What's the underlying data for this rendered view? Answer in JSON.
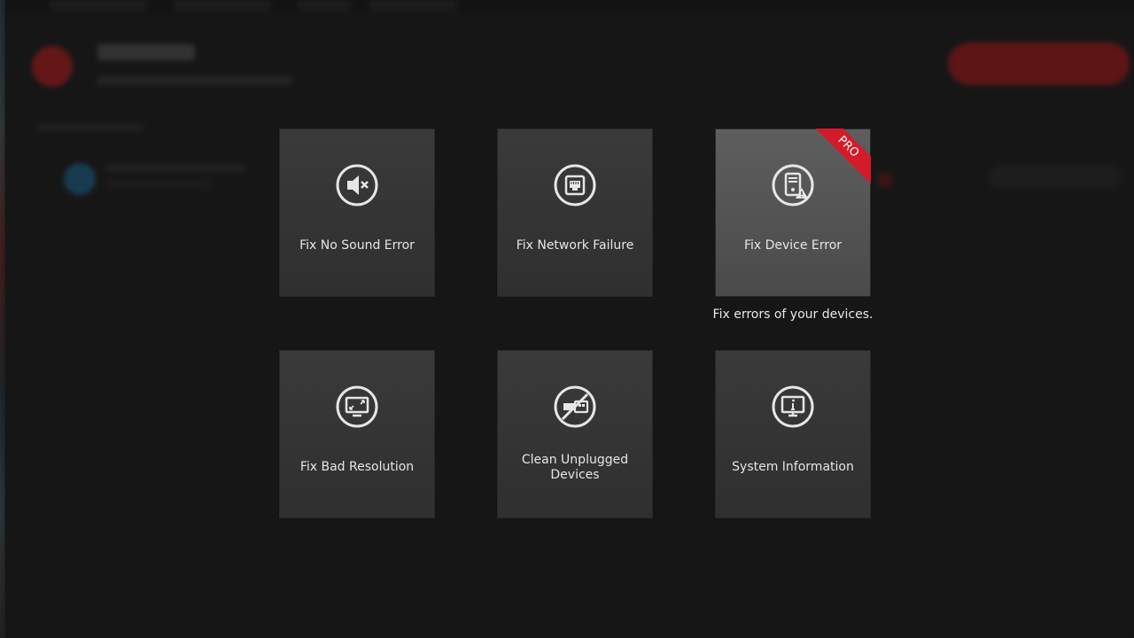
{
  "tiles": [
    {
      "label": "Fix No Sound Error",
      "icon": "mute-speaker-icon"
    },
    {
      "label": "Fix Network Failure",
      "icon": "network-port-icon"
    },
    {
      "label": "Fix Device Error",
      "icon": "device-warning-icon",
      "badge": "PRO"
    },
    {
      "label": "Fix Bad Resolution",
      "icon": "resolution-monitor-icon"
    },
    {
      "label_line1": "Clean Unplugged",
      "label_line2": "Devices",
      "icon": "unplugged-device-icon"
    },
    {
      "label": "System Information",
      "icon": "system-info-icon"
    }
  ],
  "tooltip": "Fix errors of your devices.",
  "colors": {
    "background": "#181818",
    "tile": "#333333",
    "tile_hover": "#555555",
    "pro_badge": "#d31b2a",
    "icon_stroke": "#e6e6e6"
  }
}
